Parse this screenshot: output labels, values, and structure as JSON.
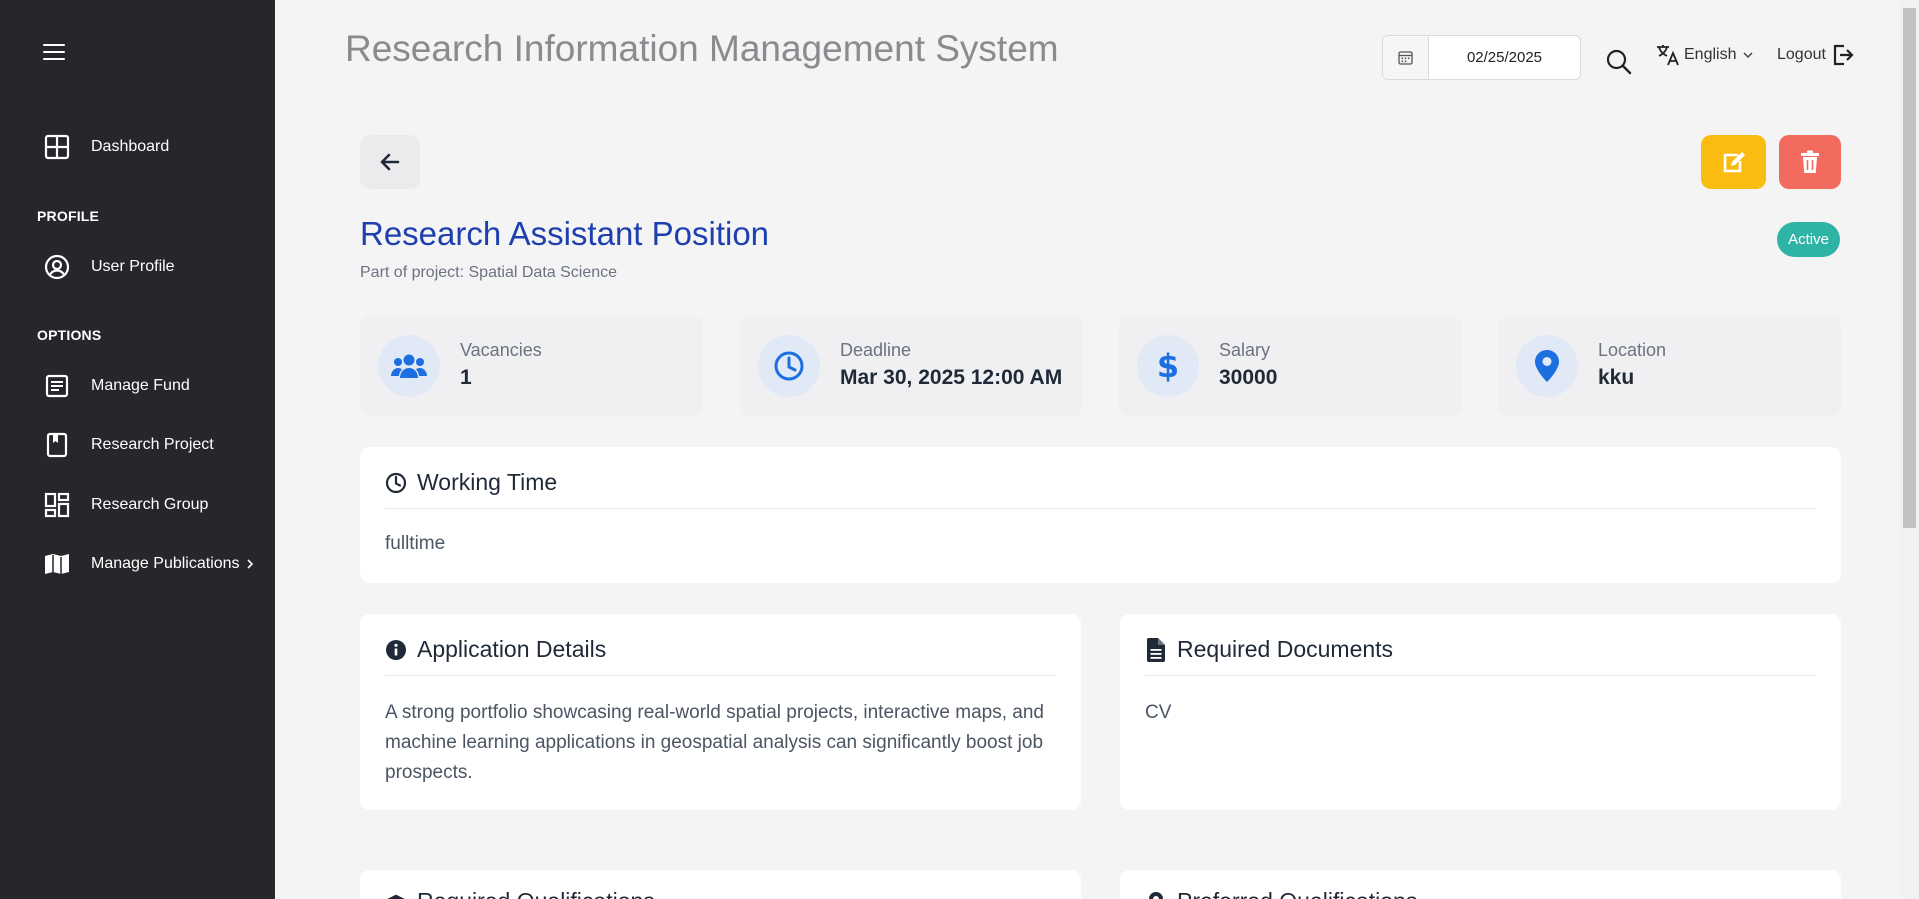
{
  "sidebar": {
    "dashboard": "Dashboard",
    "profile_section": "PROFILE",
    "user_profile": "User Profile",
    "options_section": "OPTIONS",
    "manage_fund": "Manage Fund",
    "research_project": "Research Project",
    "research_group": "Research Group",
    "manage_publications": "Manage Publications"
  },
  "header": {
    "title": "Research Information Management System",
    "date": "02/25/2025",
    "language": "English",
    "logout": "Logout"
  },
  "position": {
    "title": "Research Assistant Position",
    "subtitle": "Part of project: Spatial Data Science",
    "status": "Active",
    "stats": [
      {
        "label": "Vacancies",
        "value": "1",
        "icon": "users-icon"
      },
      {
        "label": "Deadline",
        "value": "Mar 30, 2025 12:00 AM",
        "icon": "clock-icon"
      },
      {
        "label": "Salary",
        "value": "30000",
        "icon": "dollar-icon"
      },
      {
        "label": "Location",
        "value": "kku",
        "icon": "map-pin-icon"
      }
    ],
    "working_time": {
      "title": "Working Time",
      "body": "fulltime"
    },
    "application_details": {
      "title": "Application Details",
      "body": "A strong portfolio showcasing real-world spatial projects, interactive maps, and machine learning applications in geospatial analysis can significantly boost job prospects."
    },
    "required_documents": {
      "title": "Required Documents",
      "body": "CV"
    },
    "required_qualifications": {
      "title": "Required Qualifications"
    },
    "preferred_qualifications": {
      "title": "Preferred Qualifications"
    }
  },
  "colors": {
    "sidebar_bg": "#26262b",
    "accent_blue": "#1e40af",
    "icon_blue": "#1d6fe0",
    "edit_yellow": "#fbbc12",
    "delete_red": "#f36a5e",
    "badge_teal": "#2fb3a4"
  }
}
